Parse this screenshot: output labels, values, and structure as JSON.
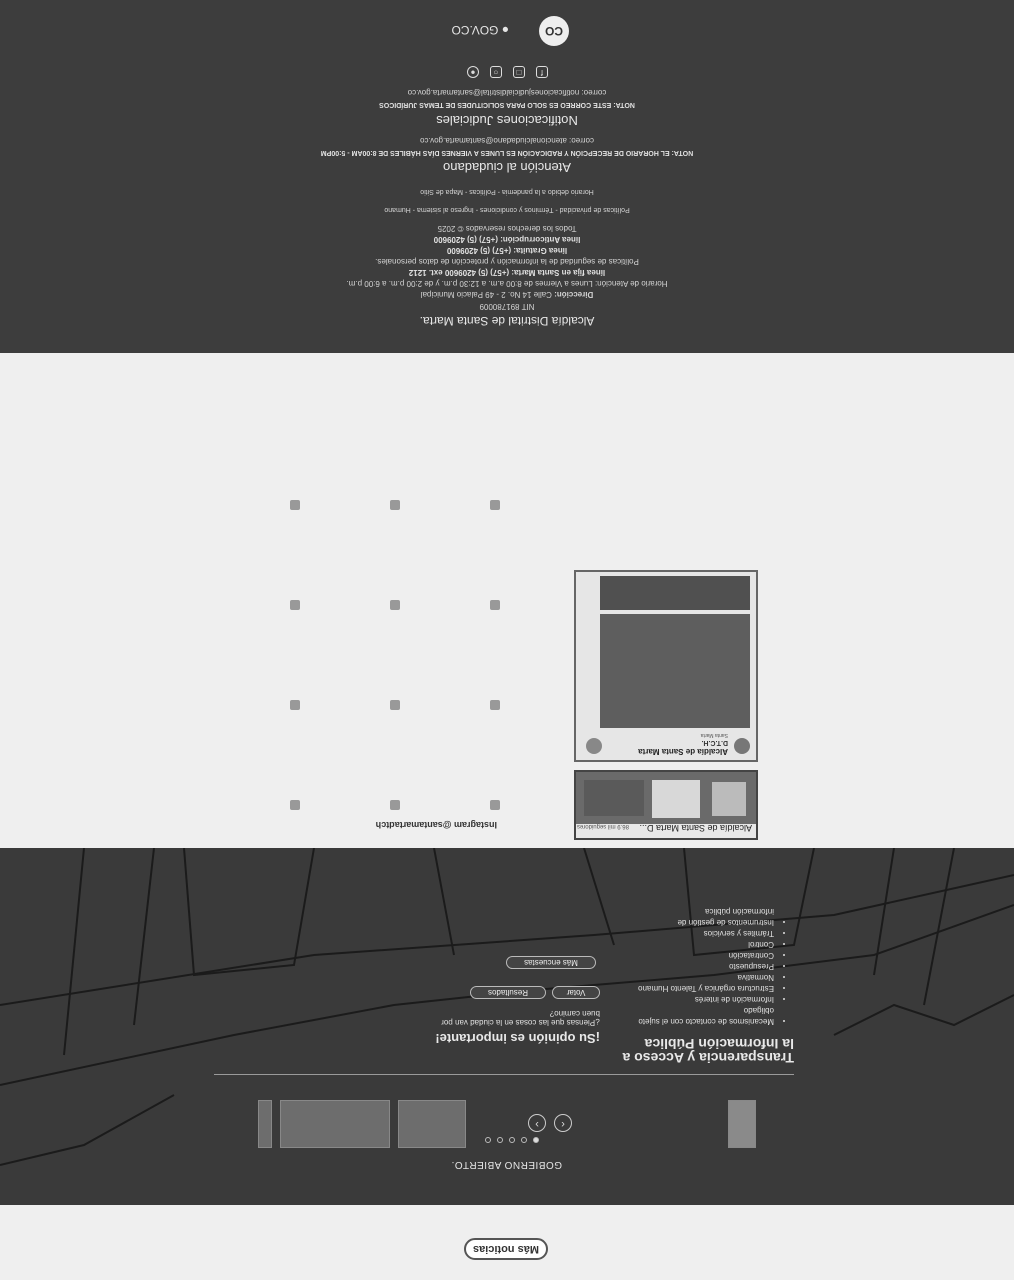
{
  "news": {
    "more_label": "Más noticias"
  },
  "gobierno": {
    "title": "GOBIERNO ABIERTO.",
    "transparencia_title_1": "Transparencia y Acceso a",
    "transparencia_title_2": "la Información Pública",
    "items": [
      "Mecanismos de contacto con el sujeto obligado",
      "Información de interés",
      "Estructura orgánica y Talento Humano",
      "Normativa",
      "Presupuesto",
      "Contratación",
      "Control",
      "Trámites y servicios",
      "Instrumentos de gestión de información pública"
    ],
    "opinion_title": "¡Su opinión es importante!",
    "opinion_question": "¿Piensas que las cosas en la ciudad van por buen camino?",
    "vote_label": "Votar",
    "results_label": "Resultados",
    "more_polls_label": "Más encuestas"
  },
  "instagram": {
    "title": "Instagram @santamartadtch",
    "card1_name": "Alcaldía de Santa Marta D...",
    "card1_sub": "86.9 mil seguidores",
    "card2_name": "Alcaldía de Santa Marta",
    "card2_sub": "D.T.C.H.",
    "card2_meta": "Santa Marta"
  },
  "footer": {
    "entity": "Alcaldía Distrital de Santa Marta.",
    "nit": "NIT 891780009",
    "direccion_label": "Dirección:",
    "direccion": "Calle 14 No. 2 - 49 Palacio Municipal",
    "horario": "Horario de Atención: Lunes a Viernes de 8:00 a.m. a 12:30 p.m. y de 2:00 p.m. a 6:00 p.m.",
    "linea_fija": "línea fija en Santa Marta: (+57) (5) 4209600 ext. 1212",
    "politicas_datos": "Políticas de seguridad de la información y protección de datos personales.",
    "linea_gratuita": "línea Gratuita: (+57) (5) 4209600",
    "linea_anticorrupcion": "línea Anticorrupción: (+57) (5) 4209600",
    "copyright": "Todos los derechos reservados © 2025",
    "links_row1": "Políticas de privacidad  -  Términos y condiciones  -  Ingreso al sistema  -  Humano",
    "links_row2": "Horario debido a la pandemia  -  Políticas  -  Mapa de Sitio",
    "atencion_title": "Atención al ciudadano",
    "atencion_nota": "NOTA: EL HORARIO DE RECEPCIÓN Y RADICACIÓN ES LUNES A VIERNES DÍAS HÁBILES DE 8:00AM - 5:00PM",
    "atencion_correo": "correo: atencionalciudadano@santamarta.gov.co",
    "notif_title": "Notificaciones Judiciales",
    "notif_nota": "NOTA: ESTE CORREO ES SOLO PARA SOLICITUDES DE TEMAS JURÍDICOS",
    "notif_correo": "correo: notificacionesjudicialdistrital@santamarta.gov.co",
    "govco_label": "GOV.CO",
    "co_label": "CO"
  }
}
